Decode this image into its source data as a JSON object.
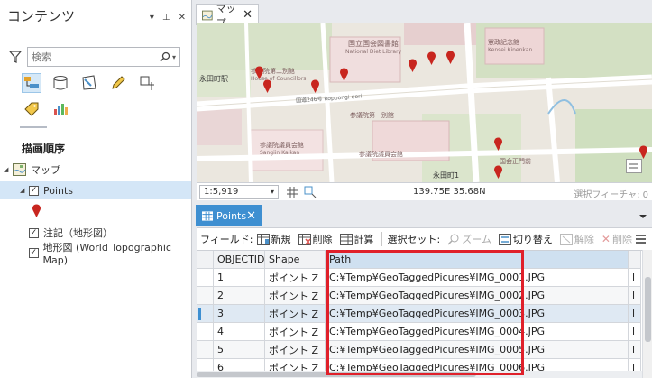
{
  "contents": {
    "title": "コンテンツ",
    "search_placeholder": "検索",
    "heading": "描画順序",
    "tree": {
      "map_label": "マップ",
      "points_label": "Points",
      "annotation_label": "注記（地形図）",
      "basemap_label": "地形図 (World Topographic Map)"
    }
  },
  "map_tab": {
    "label": "マップ"
  },
  "map_labels": {
    "national_diet_library": "国立国会図書館",
    "national_diet_library_en": "National Diet Library",
    "house_of_councillors": "参議院第二別館",
    "house_of_councillors_en": "House of Councillors",
    "nagatacho_station": "永田町駅",
    "kensei_kinenkan": "憲政記念館",
    "kensei_kinenkan_en": "Kensei Kinenkan",
    "nagatacho_1": "永田町1",
    "sanno_shinnai": "参議院第一別館",
    "giin_kaikan": "参議院議員会館",
    "giin_kaikan_en": "Sangiin Kaikan",
    "seimon": "国会正門前",
    "ministries": "参議院議員会館",
    "road_label": "国道246号 Roppongi-dori"
  },
  "map_status": {
    "scale": "1:5,919",
    "coords": "139.75E 35.68N",
    "selected_features": "選択フィーチャ: 0"
  },
  "table_tab": {
    "label": "Points"
  },
  "toolbar": {
    "field_label": "フィールド:",
    "new_label": "新規",
    "delete_label": "削除",
    "calc_label": "計算",
    "selection_label": "選択セット:",
    "zoom_label": "ズーム",
    "switch_label": "切り替え",
    "clear_label": "解除",
    "delete_sel_label": "削除"
  },
  "table": {
    "headers": [
      "OBJECTID",
      "Shape",
      "Path"
    ],
    "rows": [
      {
        "objectid": "1",
        "shape": "ポイント Z",
        "path": "C:¥Temp¥GeoTaggedPicures¥IMG_0001.JPG"
      },
      {
        "objectid": "2",
        "shape": "ポイント Z",
        "path": "C:¥Temp¥GeoTaggedPicures¥IMG_0002.JPG"
      },
      {
        "objectid": "3",
        "shape": "ポイント Z",
        "path": "C:¥Temp¥GeoTaggedPicures¥IMG_0003.JPG"
      },
      {
        "objectid": "4",
        "shape": "ポイント Z",
        "path": "C:¥Temp¥GeoTaggedPicures¥IMG_0004.JPG"
      },
      {
        "objectid": "5",
        "shape": "ポイント Z",
        "path": "C:¥Temp¥GeoTaggedPicures¥IMG_0005.JPG"
      },
      {
        "objectid": "6",
        "shape": "ポイント Z",
        "path": "C:¥Temp¥GeoTaggedPicures¥IMG_0006.JPG"
      }
    ],
    "selected_row": 3
  },
  "colors": {
    "accent": "#3e8fd1",
    "marker": "#c8261f",
    "highlight": "#e0202a",
    "selection": "#d4e6f7"
  },
  "icons": [
    "funnel-icon",
    "search-icon",
    "list-by-drawing-order-icon",
    "list-by-source-icon",
    "list-by-selection-icon",
    "list-by-editing-icon",
    "list-by-snapping-icon",
    "list-by-labeling-icon",
    "list-by-charts-icon",
    "map-icon",
    "point-symbol-icon",
    "table-icon",
    "add-field-icon",
    "delete-field-icon",
    "calculate-icon",
    "zoom-to-icon",
    "switch-selection-icon",
    "clear-selection-icon",
    "delete-selected-icon",
    "menu-icon"
  ]
}
